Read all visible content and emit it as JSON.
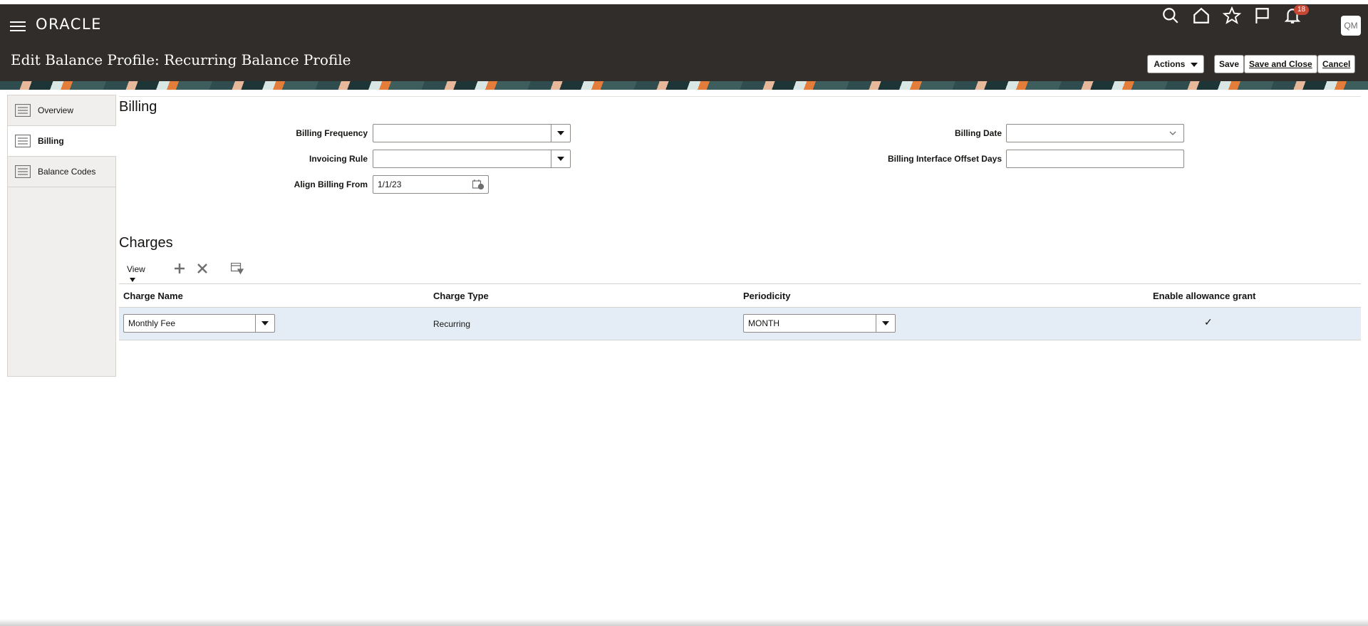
{
  "header": {
    "logo": "ORACLE",
    "notifications_count": "18",
    "avatar_initials": "QM",
    "page_title": "Edit Balance Profile: Recurring Balance Profile",
    "buttons": {
      "actions": "Actions",
      "save": "Save",
      "save_close": "Save and Close",
      "cancel": "Cancel"
    }
  },
  "sidebar": {
    "tabs": [
      {
        "label": "Overview",
        "active": false
      },
      {
        "label": "Billing",
        "active": true
      },
      {
        "label": "Balance Codes",
        "active": false
      }
    ]
  },
  "billing": {
    "section_title": "Billing",
    "billing_frequency": {
      "label": "Billing Frequency",
      "value": ""
    },
    "invoicing_rule": {
      "label": "Invoicing Rule",
      "value": ""
    },
    "align_billing_from": {
      "label": "Align Billing From",
      "value": "1/1/23"
    },
    "billing_date": {
      "label": "Billing Date",
      "value": ""
    },
    "billing_interface_offset_days": {
      "label": "Billing Interface Offset Days",
      "value": ""
    }
  },
  "charges": {
    "section_title": "Charges",
    "toolbar": {
      "view": "View"
    },
    "columns": [
      "Charge Name",
      "Charge Type",
      "Periodicity",
      "Enable allowance grant"
    ],
    "rows": [
      {
        "charge_name": "Monthly Fee",
        "charge_type": "Recurring",
        "periodicity": "MONTH",
        "allowance_grant": "✓"
      }
    ]
  },
  "colors": {
    "header_bg": "#312d2a",
    "row_selected": "#e4edf6",
    "badge": "#c74634"
  }
}
